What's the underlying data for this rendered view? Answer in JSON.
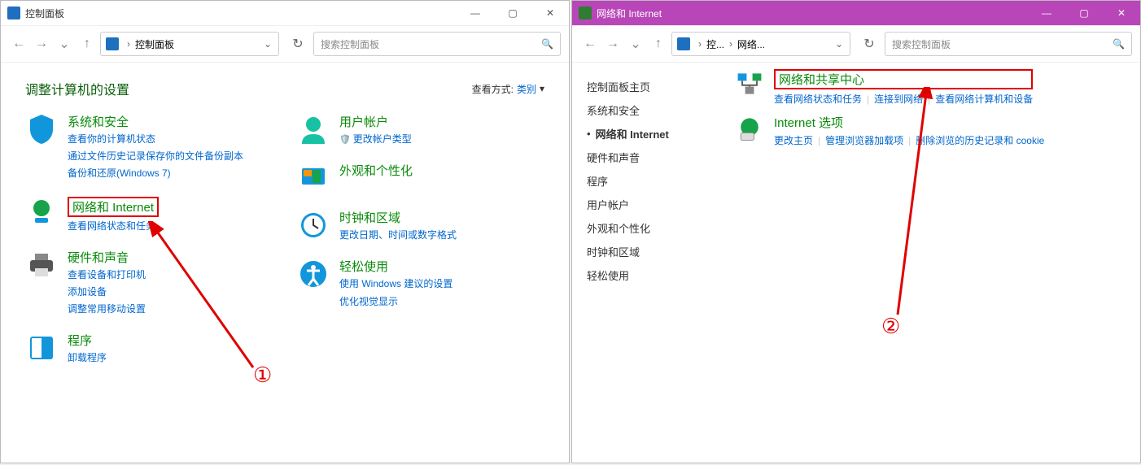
{
  "win1": {
    "title": "控制面板",
    "address": {
      "root": "控制面板"
    },
    "search_placeholder": "搜索控制面板",
    "heading": "调整计算机的设置",
    "viewby_label": "查看方式:",
    "viewby_value": "类别",
    "left_col": [
      {
        "title": "系统和安全",
        "links": [
          "查看你的计算机状态",
          "通过文件历史记录保存你的文件备份副本",
          "备份和还原(Windows 7)"
        ]
      },
      {
        "title": "网络和 Internet",
        "links": [
          "查看网络状态和任务"
        ],
        "highlight": true
      },
      {
        "title": "硬件和声音",
        "links": [
          "查看设备和打印机",
          "添加设备",
          "调整常用移动设置"
        ]
      },
      {
        "title": "程序",
        "links": [
          "卸载程序"
        ]
      }
    ],
    "right_col": [
      {
        "title": "用户帐户",
        "links": [
          "更改帐户类型"
        ]
      },
      {
        "title": "外观和个性化",
        "links": []
      },
      {
        "title": "时钟和区域",
        "links": [
          "更改日期、时间或数字格式"
        ]
      },
      {
        "title": "轻松使用",
        "links": [
          "使用 Windows 建议的设置",
          "优化视觉显示"
        ]
      }
    ],
    "annotation": "①"
  },
  "win2": {
    "title": "网络和 Internet",
    "address": {
      "crumb1": "控...",
      "crumb2": "网络..."
    },
    "search_placeholder": "搜索控制面板",
    "sidebar": [
      {
        "label": "控制面板主页",
        "active": false
      },
      {
        "label": "系统和安全",
        "active": false
      },
      {
        "label": "网络和 Internet",
        "active": true
      },
      {
        "label": "硬件和声音",
        "active": false
      },
      {
        "label": "程序",
        "active": false
      },
      {
        "label": "用户帐户",
        "active": false
      },
      {
        "label": "外观和个性化",
        "active": false
      },
      {
        "label": "时钟和区域",
        "active": false
      },
      {
        "label": "轻松使用",
        "active": false
      }
    ],
    "groups": [
      {
        "title": "网络和共享中心",
        "highlight": true,
        "links": [
          "查看网络状态和任务",
          "连接到网络",
          "查看网络计算机和设备"
        ]
      },
      {
        "title": "Internet 选项",
        "highlight": false,
        "links": [
          "更改主页",
          "管理浏览器加载项",
          "删除浏览的历史记录和 cookie"
        ]
      }
    ],
    "annotation": "②"
  }
}
